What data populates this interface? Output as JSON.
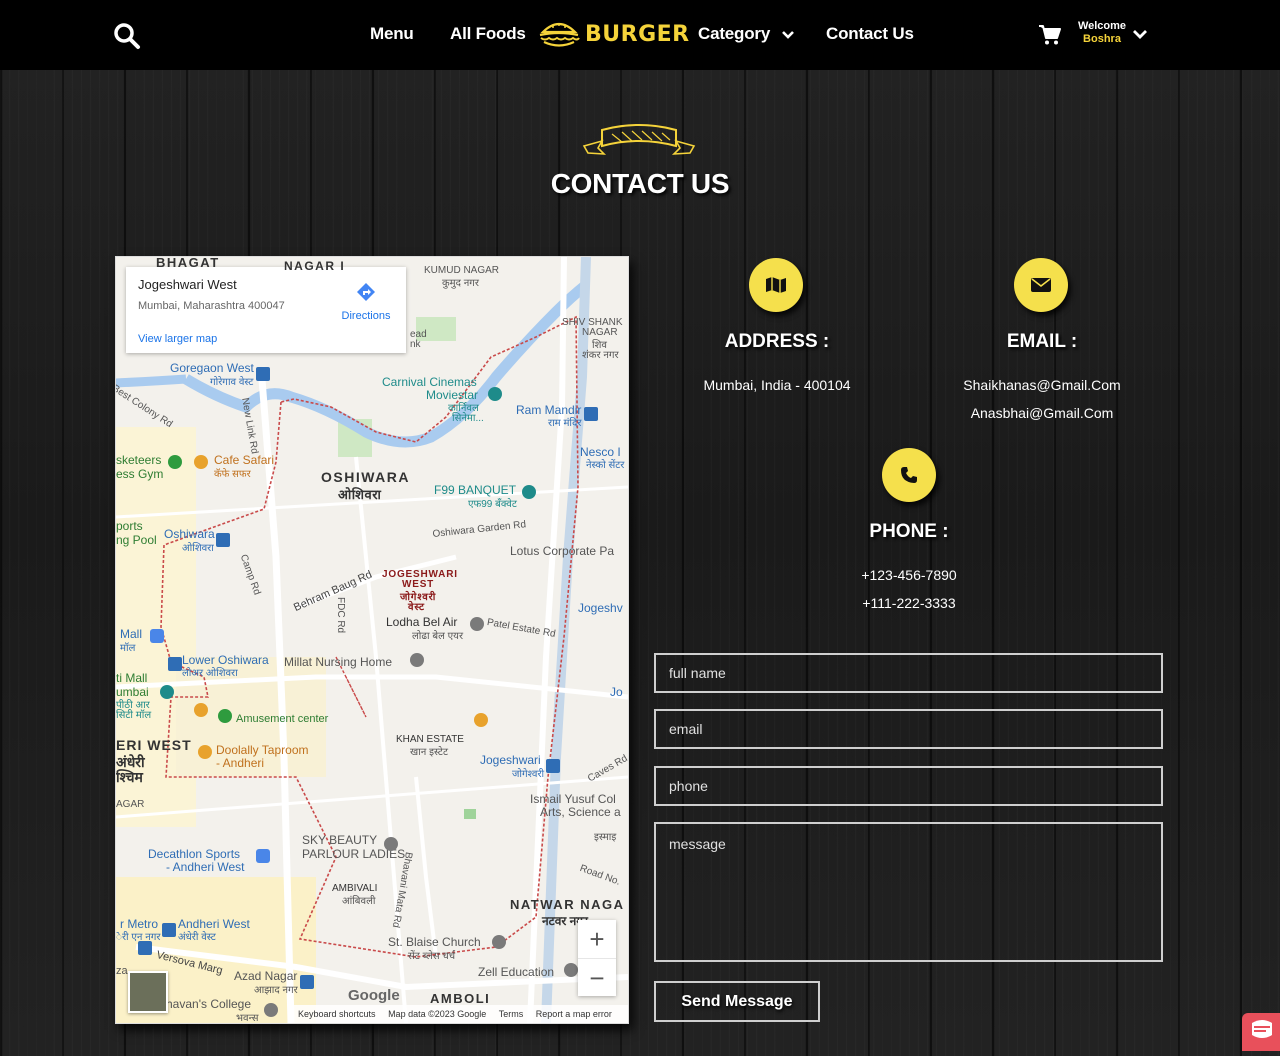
{
  "header": {
    "nav": [
      "Menu",
      "All Foods",
      "Category",
      "Contact Us"
    ],
    "logo_text": "BURGER",
    "welcome_label": "Welcome",
    "user_name": "Boshra"
  },
  "page": {
    "title": "CONTACT US"
  },
  "map": {
    "card_title": "Jogeshwari West",
    "card_address": "Mumbai, Maharashtra 400047",
    "directions_label": "Directions",
    "view_larger": "View larger map",
    "labels": {
      "bhagat": "BHAGAT",
      "nagar_i": "NAGAR I",
      "kumud": "KUMUD NAGAR",
      "kumud_dev": "कुमुद नगर",
      "shiv_shank": "SHIV SHANK",
      "nagar": "NAGAR",
      "shiv_dev": "शिव",
      "shankar_dev": "शंकर नगर",
      "head": "ead",
      "nk": "nk",
      "goregaon": "Goregaon West",
      "goregaon_dev": "गोरेगाव वेस्ट",
      "best_colony": "Best Colony Rd",
      "new_link": "New Link Rd",
      "carnival": "Carnival Cinemas",
      "moviestar": "Moviestar",
      "carnival_dev": "कार्निवल",
      "cinema_dev": "सिनेमा...",
      "ram_mandir": "Ram Mandir",
      "ram_dev": "राम मंदिर",
      "nesco": "Nesco I",
      "nesco_dev": "नेस्को सेंटर",
      "skeeters": "sketeers",
      "ess_gym": "ess Gym",
      "cafe_safari": "Cafe Safari",
      "cafe_dev": "कॅफे सफर",
      "oshiwara": "OSHIWARA",
      "oshiwara_dev": "ओशिवरा",
      "f99": "F99 BANQUET",
      "f99_dev": "एफ99 बँक्वेट",
      "oshiwara_garden": "Oshiwara Garden Rd",
      "ports": "ports",
      "ng_pool": "ng Pool",
      "oshiwara_stn": "Oshiwara",
      "oshiwara_stn_dev": "ओशिवरा",
      "lotus": "Lotus Corporate Pa",
      "camp_rd": "Camp Rd",
      "behram": "Behram Baug Rd",
      "fdc": "FDC Rd",
      "jog_red_1": "JOGESHWARI",
      "jog_red_2": "WEST",
      "jog_red_3": "जोगेश्वरी",
      "jog_red_4": "वेस्ट",
      "jogesh_e": "Jogeshv",
      "lodha": "Lodha Bel Air",
      "lodha_dev": "लोढा बेल एयर",
      "patel": "Patel Estate Rd",
      "mall": "Mall",
      "mall_dev": "मॉल",
      "lower_oshiwara": "Lower Oshiwara",
      "lower_dev": "लोअर ओशिवरा",
      "millat": "Millat Nursing Home",
      "ti_mall": "ti Mall",
      "umbai": "umbai",
      "umbai_dev1": "पीठी आर",
      "umbai_dev2": "सिटी मॉल",
      "jo": "Jo",
      "amusement": "Amusement center",
      "eri_west": "ERI WEST",
      "andheri_dev": "अंधेरी",
      "west_dev": "श्चिम",
      "doolally": "Doolally Taproom",
      "doolally_2": "- Andheri",
      "khan": "KHAN ESTATE",
      "khan_dev": "खान इस्टेट",
      "jog_stn": "Jogeshwari",
      "jog_stn_dev": "जोगेश्वरी",
      "caves": "Caves Rd",
      "agar": "AGAR",
      "ismail": "Ismail Yusuf Col",
      "arts": "Arts, Science a",
      "ismail_dev": "इस्माइ",
      "sky1": "SKY BEAUTY",
      "sky2": "PARLOUR LADIES",
      "decathlon": "Decathlon Sports",
      "decathlon_2": "- Andheri West",
      "road_no": "Road No.",
      "ambivali": "AMBIVALI",
      "ambivali_dev": "आंबिवली",
      "bhavani": "Bhavani Mata Rd",
      "natwar": "NATWAR NAGA",
      "natwar_dev": "नटवर नगर",
      "metro": "r Metro",
      "metro_dev": "ेरी एन नगर",
      "andheri_west": "Andheri West",
      "andheri_west_dev": "अंधेरी वेस्ट",
      "st_blaise": "St. Blaise Church",
      "st_blaise_dev": "सेंट ब्लेस चर्च",
      "versova": "Versova Marg",
      "azad": "Azad Nagar",
      "azad_dev": "आझाद नगर",
      "zell": "Zell Education",
      "bhavans": "havan's College",
      "bhavans_dev": "भवन्स",
      "amboli": "AMBOLI",
      "za": "za"
    },
    "zoom_in": "+",
    "zoom_out": "−",
    "google": "Google",
    "footer": [
      "Keyboard shortcuts",
      "Map data ©2023 Google",
      "Terms",
      "Report a map error"
    ]
  },
  "contact": {
    "address_title": "ADDRESS :",
    "address_value": "Mumbai, India - 400104",
    "email_title": "EMAIL :",
    "emails": [
      "Shaikhanas@Gmail.Com",
      "Anasbhai@Gmail.Com"
    ],
    "phone_title": "PHONE :",
    "phones": [
      "+123-456-7890",
      "+111-222-3333"
    ]
  },
  "form": {
    "name_placeholder": "full name",
    "email_placeholder": "email",
    "phone_placeholder": "phone",
    "message_placeholder": "message",
    "submit_label": "Send Message"
  },
  "colors": {
    "accent": "#f5e04c",
    "logo": "#f5d33a",
    "header_bg": "#000000"
  },
  "icons": [
    "search-icon",
    "cart-icon",
    "chevron-down-icon",
    "map-icon",
    "envelope-icon",
    "phone-icon",
    "burger-logo-icon",
    "ribbon-icon",
    "directions-icon",
    "chat-icon"
  ]
}
